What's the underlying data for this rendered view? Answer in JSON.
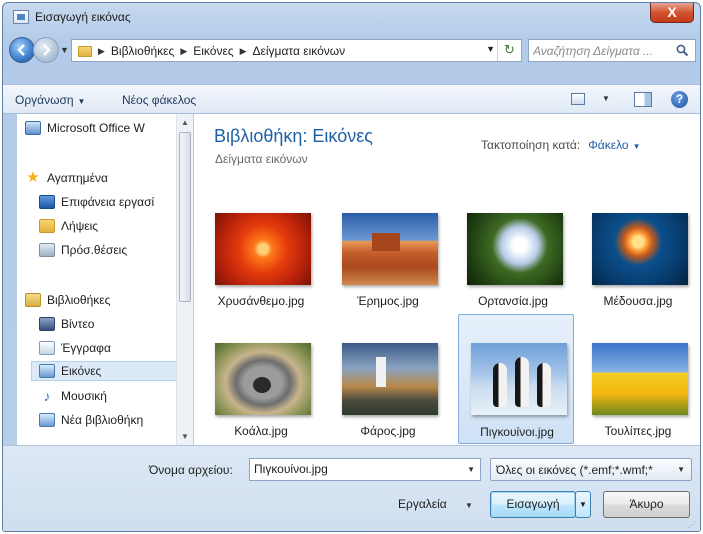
{
  "window": {
    "title": "Εισαγωγή εικόνας",
    "close_label": "X"
  },
  "address_bar": {
    "crumbs": [
      "Βιβλιοθήκες",
      "Εικόνες",
      "Δείγματα εικόνων"
    ],
    "search_placeholder": "Αναζήτηση Δείγματα ..."
  },
  "toolbar": {
    "organize_label": "Οργάνωση",
    "new_folder_label": "Νέος φάκελος",
    "help_label": "?"
  },
  "nav_pane": {
    "items": [
      {
        "label": "Microsoft Office W",
        "icon": "office-icon"
      },
      {
        "label": "Αγαπημένα",
        "icon": "star-icon"
      },
      {
        "label": "Επιφάνεια εργασί",
        "icon": "desktop-icon"
      },
      {
        "label": "Λήψεις",
        "icon": "downloads-icon"
      },
      {
        "label": "Πρόσ.θέσεις",
        "icon": "recent-places-icon"
      },
      {
        "label": "Βιβλιοθήκες",
        "icon": "libraries-icon"
      },
      {
        "label": "Βίντεο",
        "icon": "video-icon"
      },
      {
        "label": "Έγγραφα",
        "icon": "documents-icon"
      },
      {
        "label": "Εικόνες",
        "icon": "pictures-icon",
        "selected": true
      },
      {
        "label": "Μουσική",
        "icon": "music-icon"
      },
      {
        "label": "Νέα βιβλιοθήκη",
        "icon": "new-library-icon"
      }
    ]
  },
  "content": {
    "library_title": "Βιβλιοθήκη: Εικόνες",
    "library_subtitle": "Δείγματα εικόνων",
    "arrange_label": "Τακτοποίηση κατά:",
    "arrange_value": "Φάκελο",
    "files": [
      {
        "name": "Χρυσάνθεμο.jpg"
      },
      {
        "name": "Έρημος.jpg"
      },
      {
        "name": "Ορτανσία.jpg"
      },
      {
        "name": "Μέδουσα.jpg"
      },
      {
        "name": "Κοάλα.jpg"
      },
      {
        "name": "Φάρος.jpg"
      },
      {
        "name": "Πιγκουίνοι.jpg",
        "selected": true
      },
      {
        "name": "Τουλίπες.jpg"
      }
    ]
  },
  "footer": {
    "filename_label": "Όνομα αρχείου:",
    "filename_value": "Πιγκουίνοι.jpg",
    "filter_value": "Όλες οι εικόνες (*.emf;*.wmf;*",
    "tools_label": "Εργαλεία",
    "insert_label": "Εισαγωγή",
    "cancel_label": "Άκυρο"
  }
}
